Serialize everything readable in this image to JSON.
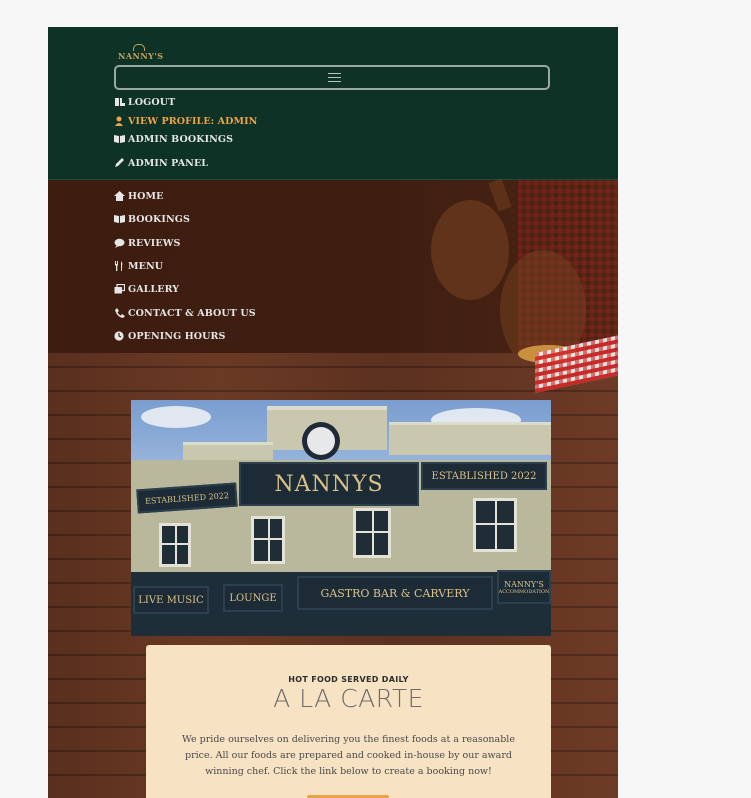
{
  "logo": {
    "text": "NANNY'S"
  },
  "topnav": {
    "items": [
      {
        "label": "LOGOUT",
        "icon": "logout-icon"
      },
      {
        "label": "VIEW PROFILE: ADMIN",
        "icon": "user-icon",
        "color": "#f0a44a"
      },
      {
        "label": "ADMIN BOOKINGS",
        "icon": "book-icon"
      },
      {
        "label": "ADMIN PANEL",
        "icon": "pencil-icon"
      }
    ]
  },
  "mainnav": {
    "items": [
      {
        "label": "HOME",
        "icon": "home-icon"
      },
      {
        "label": "BOOKINGS",
        "icon": "book-icon"
      },
      {
        "label": "REVIEWS",
        "icon": "comment-icon"
      },
      {
        "label": "MENU",
        "icon": "utensils-icon"
      },
      {
        "label": "GALLERY",
        "icon": "images-icon"
      },
      {
        "label": "CONTACT & ABOUT US",
        "icon": "phone-icon"
      },
      {
        "label": "OPENING HOURS",
        "icon": "clock-icon"
      }
    ]
  },
  "photo": {
    "sign_main": "NANNYS",
    "sign_left": "ESTABLISHED 2022",
    "sign_right": "ESTABLISHED 2022",
    "sign_live": "LIVE MUSIC",
    "sign_lounge": "LOUNGE",
    "sign_gastro": "GASTRO BAR & CARVERY",
    "sign_nannys": "NANNY'S",
    "sign_accom": "ACCOMMODATION"
  },
  "card": {
    "kicker": "HOT FOOD SERVED DAILY",
    "title": "A LA CARTE",
    "body": "We pride ourselves on delivering you the finest foods at a reasonable price. All our foods are prepared and cooked in-house by our award winning chef. Click the link below to create a booking now!"
  },
  "colors": {
    "nav_green": "#0e3226",
    "banner_brown": "#3d1d10",
    "accent_orange": "#f0a44a",
    "card_bg": "#f7e2c3"
  }
}
